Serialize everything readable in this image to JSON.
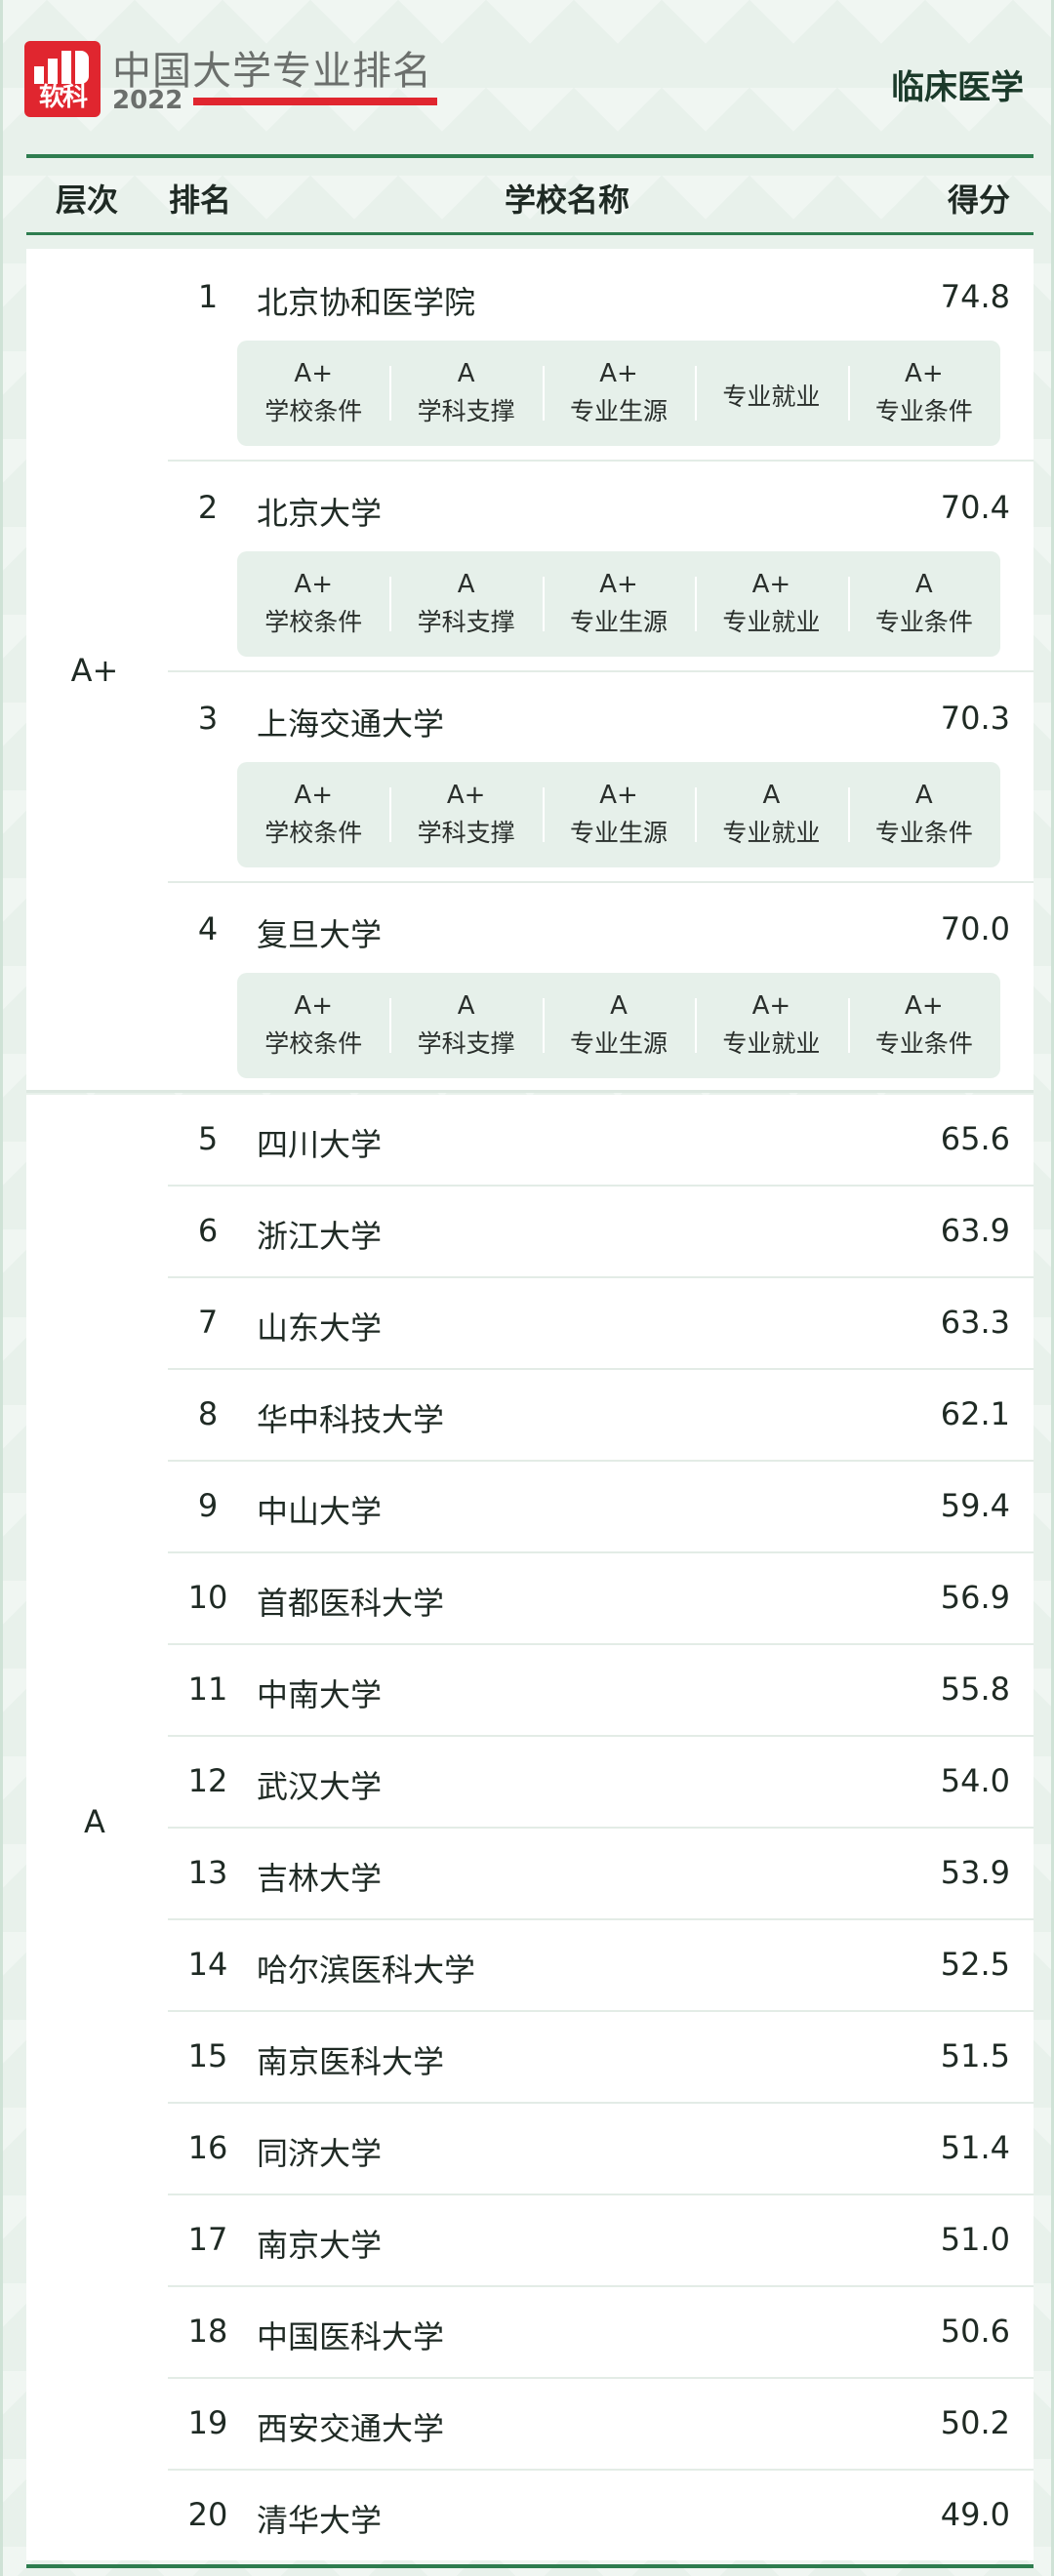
{
  "brand": {
    "logo_text": "软科",
    "title": "中国大学专业排名",
    "year": "2022"
  },
  "subject": "临床医学",
  "table_header": {
    "tier": "层次",
    "rank": "排名",
    "school": "学校名称",
    "score": "得分"
  },
  "tiers": [
    {
      "label": "A+",
      "rows": [
        {
          "rank": "1",
          "school": "北京协和医学院",
          "score": "74.8",
          "indicators": [
            {
              "grade": "A+",
              "name": "学校条件"
            },
            {
              "grade": "A",
              "name": "学科支撑"
            },
            {
              "grade": "A+",
              "name": "专业生源"
            },
            {
              "grade": "",
              "name": "专业就业"
            },
            {
              "grade": "A+",
              "name": "专业条件"
            }
          ]
        },
        {
          "rank": "2",
          "school": "北京大学",
          "score": "70.4",
          "indicators": [
            {
              "grade": "A+",
              "name": "学校条件"
            },
            {
              "grade": "A",
              "name": "学科支撑"
            },
            {
              "grade": "A+",
              "name": "专业生源"
            },
            {
              "grade": "A+",
              "name": "专业就业"
            },
            {
              "grade": "A",
              "name": "专业条件"
            }
          ]
        },
        {
          "rank": "3",
          "school": "上海交通大学",
          "score": "70.3",
          "indicators": [
            {
              "grade": "A+",
              "name": "学校条件"
            },
            {
              "grade": "A+",
              "name": "学科支撑"
            },
            {
              "grade": "A+",
              "name": "专业生源"
            },
            {
              "grade": "A",
              "name": "专业就业"
            },
            {
              "grade": "A",
              "name": "专业条件"
            }
          ]
        },
        {
          "rank": "4",
          "school": "复旦大学",
          "score": "70.0",
          "indicators": [
            {
              "grade": "A+",
              "name": "学校条件"
            },
            {
              "grade": "A",
              "name": "学科支撑"
            },
            {
              "grade": "A",
              "name": "专业生源"
            },
            {
              "grade": "A+",
              "name": "专业就业"
            },
            {
              "grade": "A+",
              "name": "专业条件"
            }
          ]
        }
      ]
    },
    {
      "label": "A",
      "rows": [
        {
          "rank": "5",
          "school": "四川大学",
          "score": "65.6"
        },
        {
          "rank": "6",
          "school": "浙江大学",
          "score": "63.9"
        },
        {
          "rank": "7",
          "school": "山东大学",
          "score": "63.3"
        },
        {
          "rank": "8",
          "school": "华中科技大学",
          "score": "62.1"
        },
        {
          "rank": "9",
          "school": "中山大学",
          "score": "59.4"
        },
        {
          "rank": "10",
          "school": "首都医科大学",
          "score": "56.9"
        },
        {
          "rank": "11",
          "school": "中南大学",
          "score": "55.8"
        },
        {
          "rank": "12",
          "school": "武汉大学",
          "score": "54.0"
        },
        {
          "rank": "13",
          "school": "吉林大学",
          "score": "53.9"
        },
        {
          "rank": "14",
          "school": "哈尔滨医科大学",
          "score": "52.5"
        },
        {
          "rank": "15",
          "school": "南京医科大学",
          "score": "51.5"
        },
        {
          "rank": "16",
          "school": "同济大学",
          "score": "51.4"
        },
        {
          "rank": "17",
          "school": "南京大学",
          "score": "51.0"
        },
        {
          "rank": "18",
          "school": "中国医科大学",
          "score": "50.6"
        },
        {
          "rank": "19",
          "school": "西安交通大学",
          "score": "50.2"
        },
        {
          "rank": "20",
          "school": "清华大学",
          "score": "49.0"
        }
      ]
    }
  ]
}
